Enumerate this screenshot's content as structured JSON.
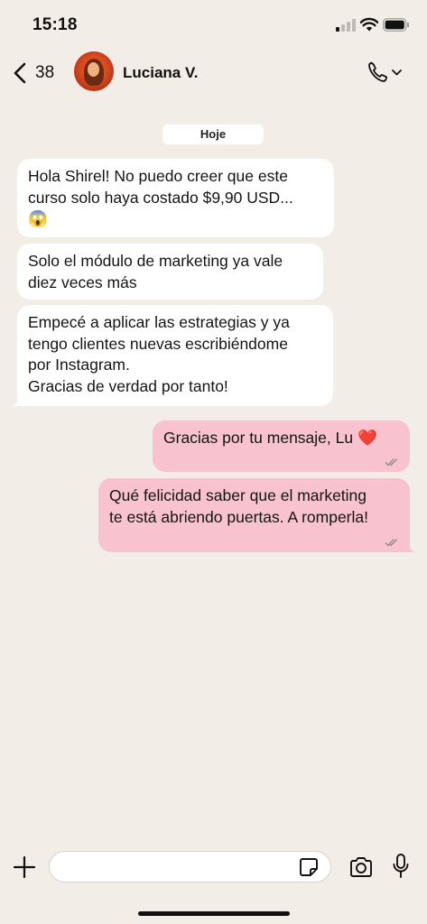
{
  "status_bar": {
    "time": "15:18"
  },
  "header": {
    "back_count": "38",
    "contact_name": "Luciana V.",
    "icons": [
      "chevron-left-icon",
      "phone-icon",
      "chevron-down-icon"
    ]
  },
  "date_label": "Hoje",
  "messages": [
    {
      "direction": "incoming",
      "lines": [
        "Hola Shirel! No puedo creer que este",
        "curso solo haya costado $9,90 USD...",
        "😱"
      ]
    },
    {
      "direction": "incoming",
      "lines": [
        "Solo el módulo de marketing ya vale",
        "diez veces más"
      ]
    },
    {
      "direction": "incoming",
      "lines": [
        "Empecé a aplicar las estrategias y ya",
        "tengo clientes nuevas escribiéndome",
        "por Instagram.",
        "Gracias de verdad por tanto!"
      ]
    },
    {
      "direction": "outgoing",
      "lines": [
        "Gracias por tu mensaje, Lu ❤️"
      ],
      "status": "read"
    },
    {
      "direction": "outgoing",
      "lines": [
        "Qué felicidad saber que el marketing",
        "te está abriendo puertas. A romperla!"
      ],
      "status": "read"
    }
  ],
  "composer": {
    "placeholder": "",
    "icons": [
      "plus-icon",
      "sticker-icon",
      "camera-icon",
      "microphone-icon"
    ]
  },
  "colors": {
    "background": "#f2ede6",
    "incoming_bubble": "#ffffff",
    "outgoing_bubble": "#f8c2cf",
    "avatar": "#d94a1d"
  }
}
